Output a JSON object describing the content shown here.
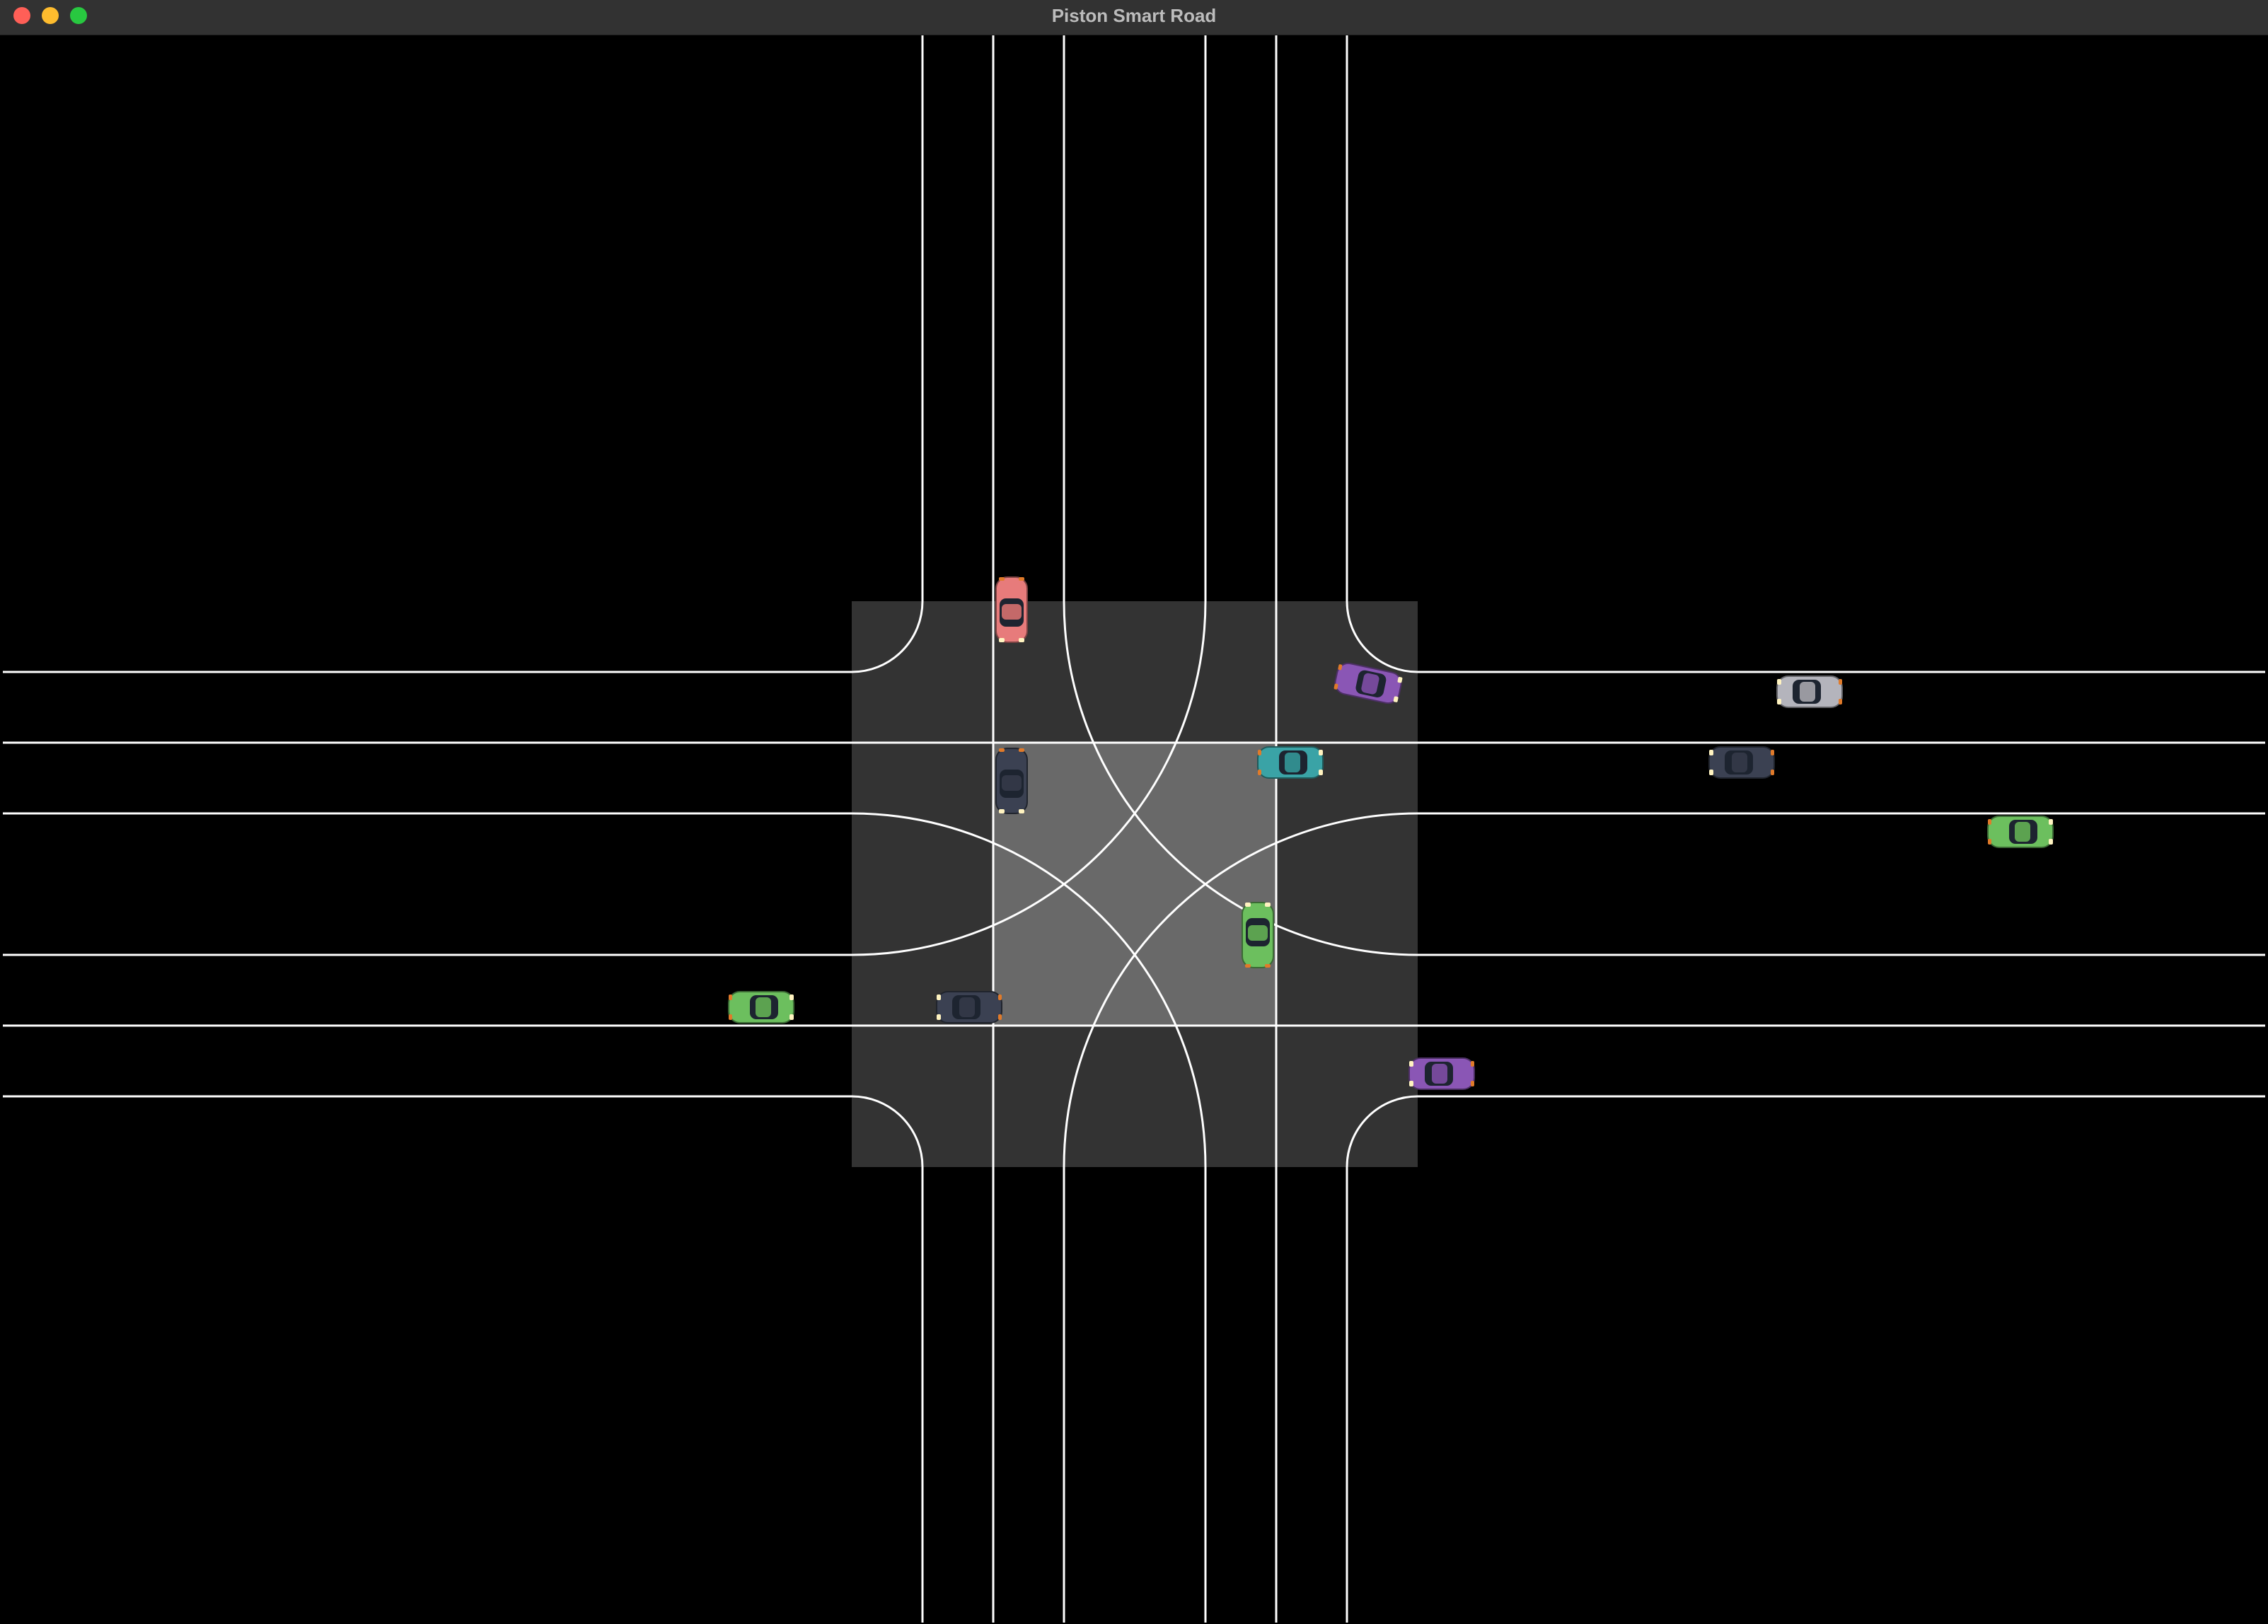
{
  "window": {
    "title": "Piston Smart Road",
    "buttons": {
      "close_color": "#ff5f57",
      "minimize_color": "#febc2e",
      "maximize_color": "#28c840"
    }
  },
  "scene": {
    "background_color": "#000000",
    "intersection_outer_color": "#333333",
    "intersection_inner_color": "#696969",
    "lane_line_color": "#ffffff",
    "vehicles": [
      {
        "name": "car-red-north",
        "color": "#e77b7b",
        "heading": "down"
      },
      {
        "name": "car-purple-ne",
        "color": "#8a56b5",
        "heading": "right-tilted"
      },
      {
        "name": "car-silver-east",
        "color": "#b4b4bc",
        "heading": "left"
      },
      {
        "name": "car-navy-north-lane",
        "color": "#3b4152",
        "heading": "down"
      },
      {
        "name": "car-teal-center",
        "color": "#3aa3a6",
        "heading": "right"
      },
      {
        "name": "car-navy-east",
        "color": "#3b4152",
        "heading": "left"
      },
      {
        "name": "car-green-east",
        "color": "#6cbf5e",
        "heading": "right"
      },
      {
        "name": "car-green-center",
        "color": "#6cbf5e",
        "heading": "up"
      },
      {
        "name": "car-green-west",
        "color": "#6cbf5e",
        "heading": "right"
      },
      {
        "name": "car-navy-west",
        "color": "#3b4152",
        "heading": "left"
      },
      {
        "name": "car-purple-se",
        "color": "#8a56b5",
        "heading": "left"
      }
    ]
  }
}
